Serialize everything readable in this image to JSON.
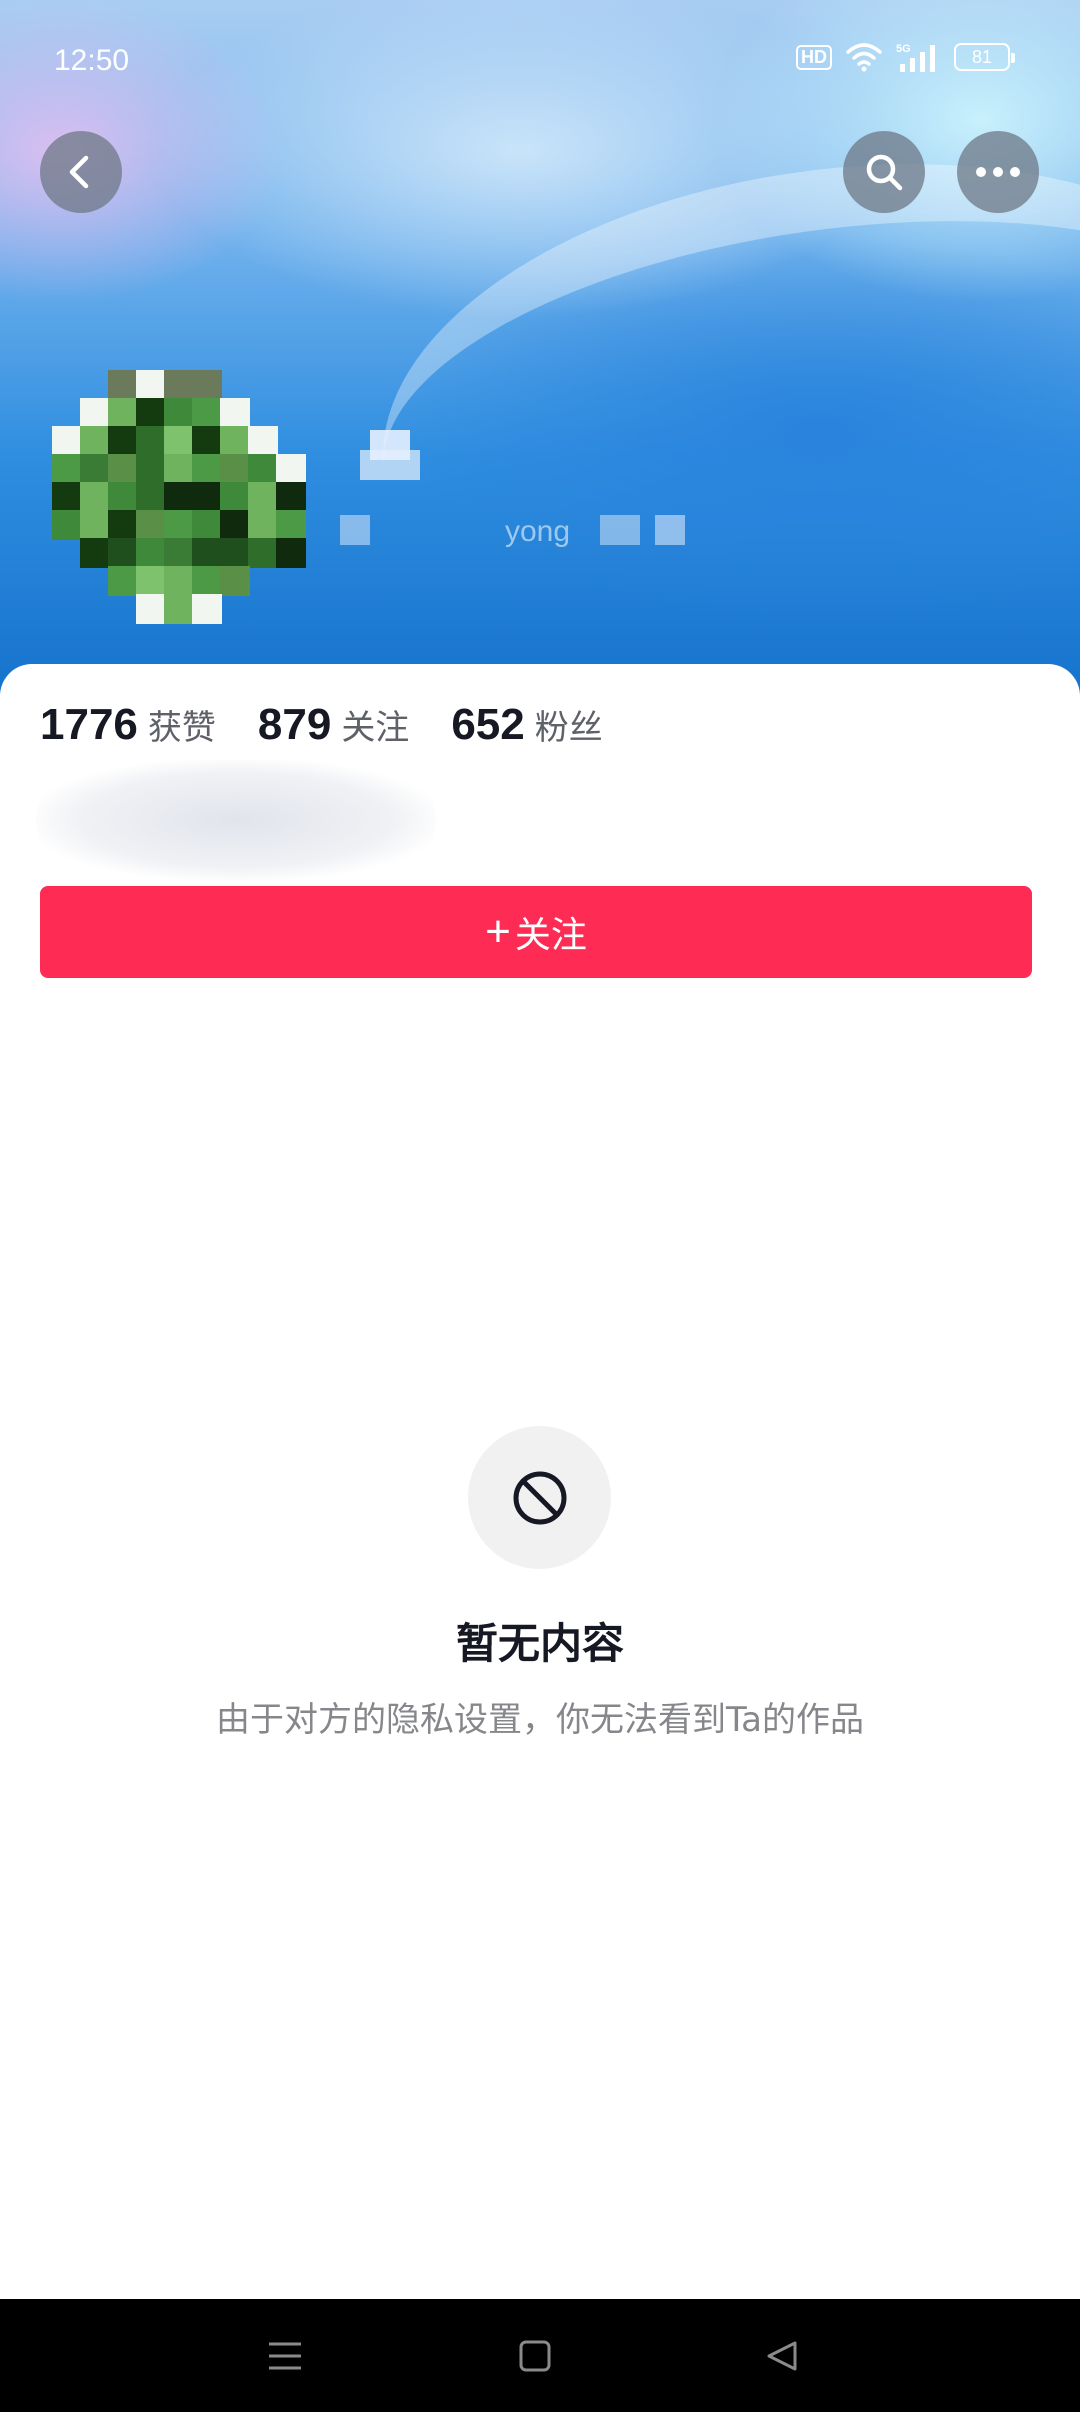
{
  "status_bar": {
    "time": "12:50",
    "hd": "HD",
    "network": "5G",
    "battery": "81",
    "icons": [
      "hd-icon",
      "wifi-icon",
      "signal-icon",
      "battery-icon"
    ]
  },
  "header": {
    "back_icon": "chevron-left-icon",
    "search_icon": "search-icon",
    "more_icon": "more-horizontal-icon",
    "handle_partial": "yong"
  },
  "stats": [
    {
      "value": "1776",
      "label": "获赞"
    },
    {
      "value": "879",
      "label": "关注"
    },
    {
      "value": "652",
      "label": "粉丝"
    }
  ],
  "follow_button": {
    "plus": "+",
    "label": "关注"
  },
  "empty_state": {
    "icon": "prohibited-icon",
    "title": "暂无内容",
    "description": "由于对方的隐私设置，你无法看到Ta的作品"
  },
  "nav": {
    "icons": [
      "menu-icon",
      "home-icon",
      "back-triangle-icon"
    ]
  },
  "colors": {
    "accent": "#fe2c55",
    "header_blue": "#1672cc",
    "text_primary": "#161823",
    "text_secondary": "#86878b",
    "nav_background": "#000000"
  }
}
